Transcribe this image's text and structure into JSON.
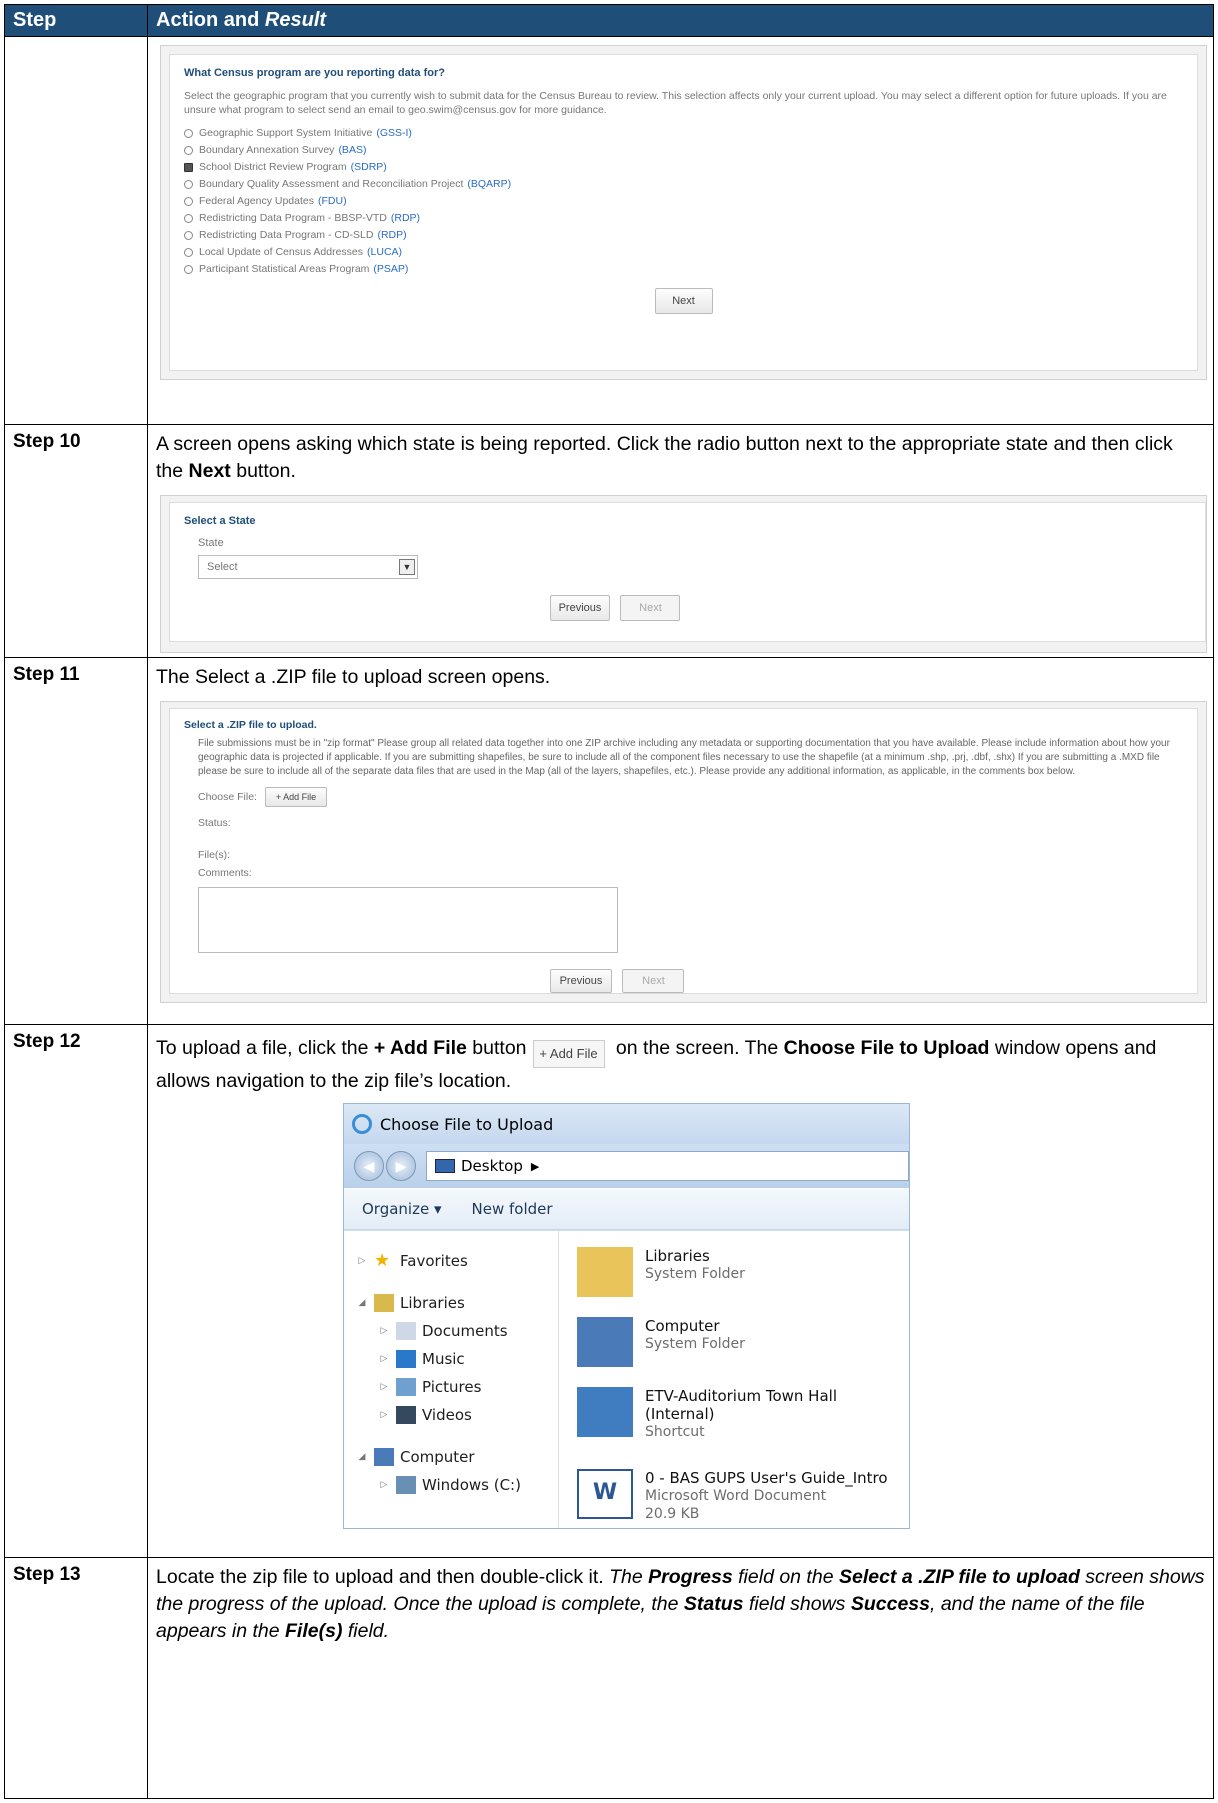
{
  "table": {
    "col1_header": "Step",
    "col2_header": "Action and",
    "col2_header_italic": "Result"
  },
  "step9": {
    "panel": {
      "question": "What Census program are you reporting data for?",
      "description": "Select the geographic program that you currently wish to submit data for the Census Bureau to review. This selection affects only your current upload. You may select a different option for future uploads. If you are unsure what program to select send an email to geo.swim@census.gov for more guidance.",
      "options": [
        {
          "label": "Geographic Support System Initiative",
          "code": "(GSS-I)",
          "checked": false
        },
        {
          "label": "Boundary Annexation Survey",
          "code": "(BAS)",
          "checked": false
        },
        {
          "label": "School District Review Program",
          "code": "(SDRP)",
          "checked": true
        },
        {
          "label": "Boundary Quality Assessment and Reconciliation Project",
          "code": "(BQARP)",
          "checked": false
        },
        {
          "label": "Federal Agency Updates",
          "code": "(FDU)",
          "checked": false
        },
        {
          "label": "Redistricting Data Program - BBSP-VTD",
          "code": "(RDP)",
          "checked": false
        },
        {
          "label": "Redistricting Data Program - CD-SLD",
          "code": "(RDP)",
          "checked": false
        },
        {
          "label": "Local Update of Census Addresses",
          "code": "(LUCA)",
          "checked": false
        },
        {
          "label": "Participant Statistical Areas Program",
          "code": "(PSAP)",
          "checked": false
        }
      ],
      "next_label": "Next"
    }
  },
  "step10": {
    "label": "Step 10",
    "text_a": "A screen opens asking which state is being reported. Click the radio button next to the appropriate state and then click the ",
    "text_bold": "Next",
    "text_b": " button.",
    "panel": {
      "title": "Select a State",
      "state_label": "State",
      "select_value": "Select",
      "previous_label": "Previous",
      "next_label": "Next"
    }
  },
  "step11": {
    "label": "Step 11",
    "text": "The Select a .ZIP file to upload screen opens.",
    "panel": {
      "title": "Select a .ZIP file to upload.",
      "description": "File submissions must be in \"zip format\" Please group all related data together into one ZIP archive including any metadata or supporting documentation that you have available. Please include information about how your geographic data is projected if applicable. If you are submitting shapefiles, be sure to include all of the component files necessary to use the shapefile (at a minimum .shp, .prj, .dbf, .shx) If you are submitting a .MXD file please be sure to include all of the separate data files that are used in the Map (all of the layers, shapefiles, etc.). Please provide any additional information, as applicable, in the comments box below.",
      "choose_file_label": "Choose File:",
      "add_file_label": "+ Add File",
      "status_label": "Status:",
      "files_label": "File(s):",
      "comments_label": "Comments:",
      "previous_label": "Previous",
      "next_label": "Next"
    }
  },
  "step12": {
    "label": "Step 12",
    "text_a": "To upload a file, click the ",
    "text_bold1": "+ Add File",
    "text_b": " button",
    "inline_button": "+ Add File",
    "text_c": " on the screen. The ",
    "text_bold2": "Choose File to Upload",
    "text_d": " window opens and allows navigation to the zip file’s location.",
    "dialog": {
      "title": "Choose File to Upload",
      "address": "Desktop",
      "organize": "Organize ▾",
      "new_folder": "New folder",
      "nav_items": [
        {
          "label": "Favorites",
          "icon": "star-icon",
          "tri": "▷",
          "indent": 0
        },
        {
          "label": "Libraries",
          "icon": "libraries-icon",
          "tri": "◢",
          "indent": 0
        },
        {
          "label": "Documents",
          "icon": "documents-icon",
          "tri": "▷",
          "indent": 1
        },
        {
          "label": "Music",
          "icon": "music-icon",
          "tri": "▷",
          "indent": 1
        },
        {
          "label": "Pictures",
          "icon": "pictures-icon",
          "tri": "▷",
          "indent": 1
        },
        {
          "label": "Videos",
          "icon": "videos-icon",
          "tri": "▷",
          "indent": 1
        },
        {
          "label": "Computer",
          "icon": "computer-icon",
          "tri": "◢",
          "indent": 0
        },
        {
          "label": "Windows (C:)",
          "icon": "drive-icon",
          "tri": "▷",
          "indent": 1
        }
      ],
      "files": [
        {
          "name": "Libraries",
          "sub": [
            "System Folder"
          ],
          "icon": "libraries-folder-icon"
        },
        {
          "name": "Computer",
          "sub": [
            "System Folder"
          ],
          "icon": "computer-icon"
        },
        {
          "name": "ETV-Auditorium Town Hall",
          "sub": [
            "(Internal)",
            "Shortcut"
          ],
          "icon": "shortcut-icon"
        },
        {
          "name": "0 - BAS GUPS User's Guide_Intro",
          "sub": [
            "Microsoft Word Document",
            "20.9 KB"
          ],
          "icon": "word-doc-icon"
        }
      ]
    }
  },
  "step13": {
    "label": "Step 13",
    "text_a": "Locate the zip file to upload and then double-click it. ",
    "i1": "The ",
    "ib1": "Progress",
    "i2": " field on the ",
    "ib2": "Select a .ZIP file to upload",
    "i3": " screen shows the progress of the upload. Once the upload is complete, the ",
    "ib3": "Status",
    "i4": " field shows ",
    "ib4": "Success",
    "i5": ", and the name of the file appears in the ",
    "ib5": "File(s)",
    "i6": " field."
  }
}
